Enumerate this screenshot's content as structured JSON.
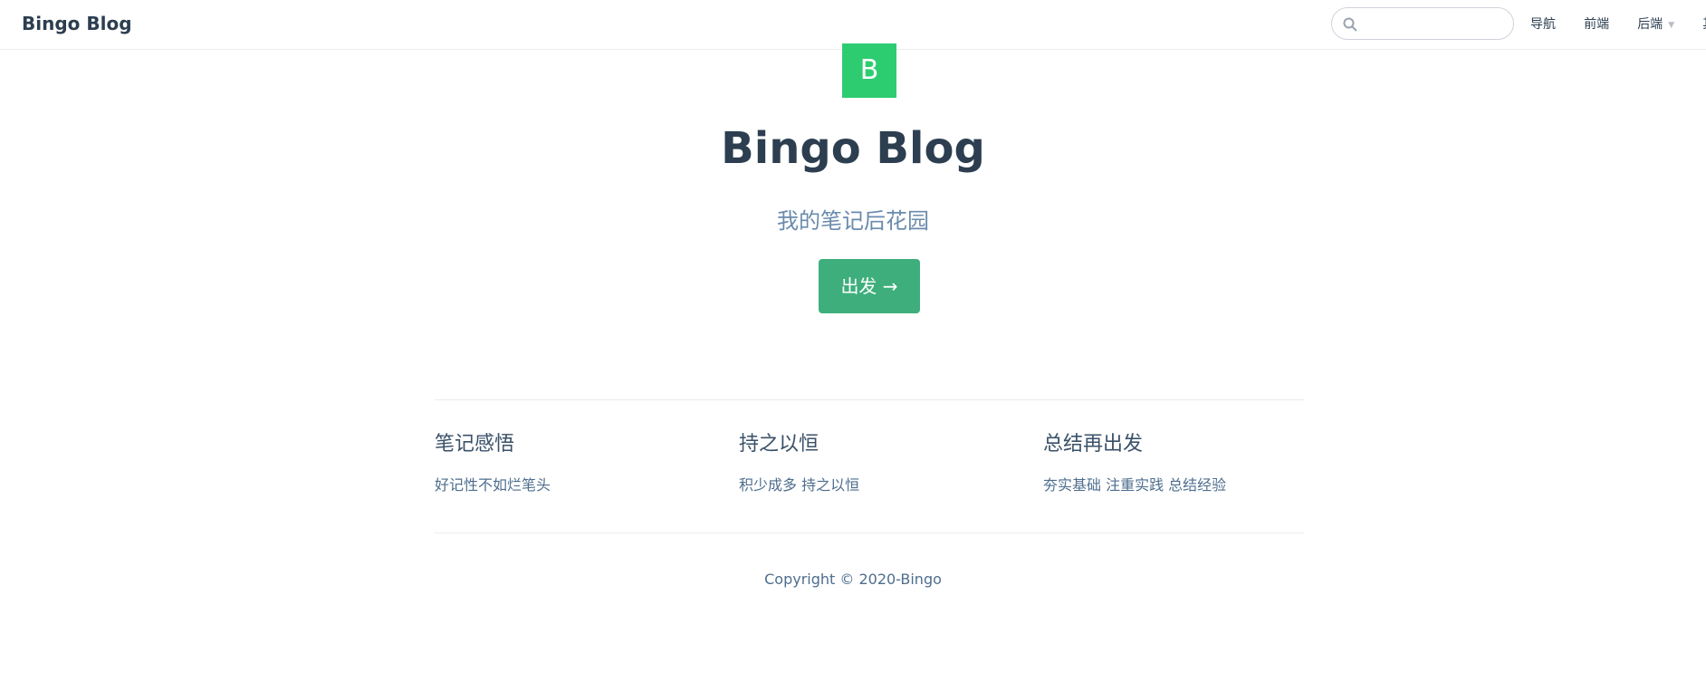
{
  "navbar": {
    "brand": "Bingo Blog",
    "search": {
      "placeholder": "",
      "value": ""
    },
    "links": [
      {
        "label": "导航"
      },
      {
        "label": "前端"
      },
      {
        "label": "后端",
        "has_dropdown": true
      },
      {
        "label": "其它"
      }
    ]
  },
  "hero": {
    "logo_letter": "B",
    "title": "Bingo Blog",
    "subtitle": "我的笔记后花园",
    "action_label": "出发 →"
  },
  "features": [
    {
      "title": "笔记感悟",
      "details": "好记性不如烂笔头"
    },
    {
      "title": "持之以恒",
      "details": "积少成多 持之以恒"
    },
    {
      "title": "总结再出发",
      "details": "夯实基础 注重实践 总结经验"
    }
  ],
  "footer": {
    "copyright": "Copyright © 2020-Bingo"
  },
  "colors": {
    "accent": "#3eaf7c",
    "logo_bg": "#2ecc71",
    "text": "#2c3e50",
    "subtitle": "#6a8bad"
  }
}
